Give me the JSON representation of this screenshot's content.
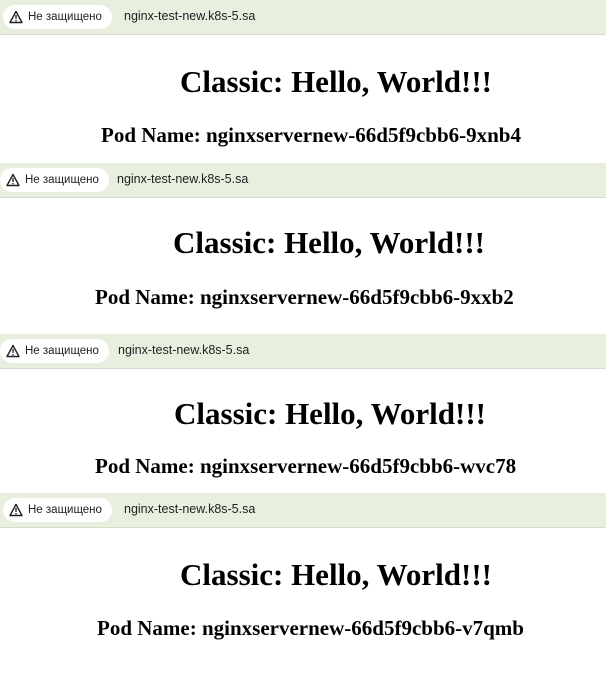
{
  "windows": [
    {
      "security_label": "Не защищено",
      "url": "nginx-test-new.k8s-5.sa",
      "heading": "Classic: Hello, World!!!",
      "pod_line": "Pod Name: nginxservernew-66d5f9cbb6-9xnb4"
    },
    {
      "security_label": "Не защищено",
      "url": "nginx-test-new.k8s-5.sa",
      "heading": "Classic: Hello, World!!!",
      "pod_line": "Pod Name: nginxservernew-66d5f9cbb6-9xxb2"
    },
    {
      "security_label": "Не защищено",
      "url": "nginx-test-new.k8s-5.sa",
      "heading": "Classic: Hello, World!!!",
      "pod_line": "Pod Name: nginxservernew-66d5f9cbb6-wvc78"
    },
    {
      "security_label": "Не защищено",
      "url": "nginx-test-new.k8s-5.sa",
      "heading": "Classic: Hello, World!!!",
      "pod_line": "Pod Name: nginxservernew-66d5f9cbb6-v7qmb"
    }
  ],
  "icons": {
    "security": "warning-triangle-icon"
  }
}
